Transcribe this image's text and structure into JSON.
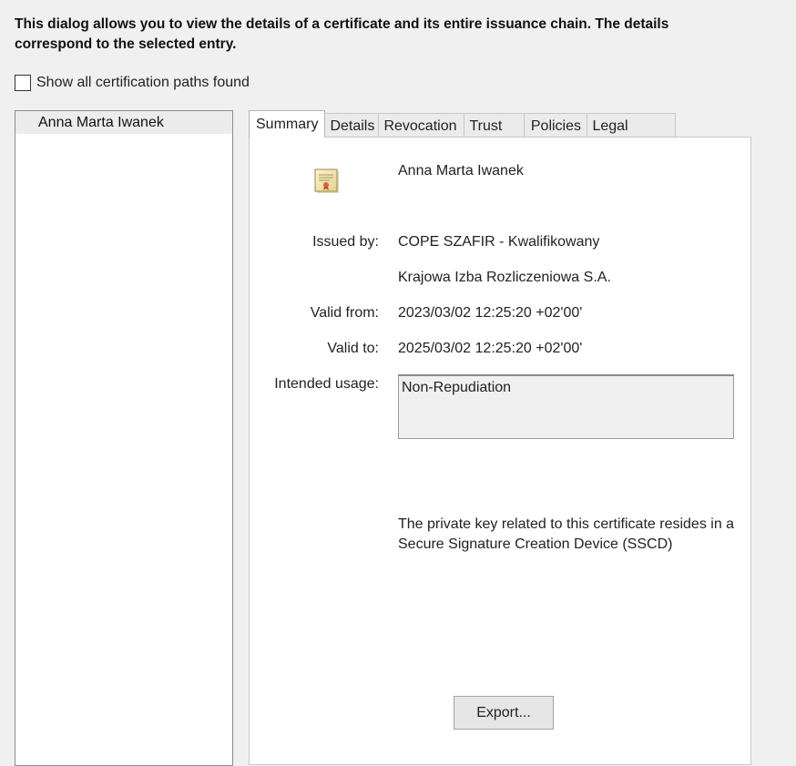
{
  "intro_text": "This dialog allows you to view the details of a certificate and its entire issuance chain. The details correspond to the selected entry.",
  "show_all_paths": {
    "label": "Show all certification paths found",
    "checked": false
  },
  "chain_tree": {
    "items": [
      {
        "label": "Anna Marta Iwanek",
        "selected": true
      }
    ]
  },
  "tabs": [
    {
      "label": "Summary",
      "active": true
    },
    {
      "label": "Details",
      "active": false
    },
    {
      "label": "Revocation",
      "active": false
    },
    {
      "label": "Trust",
      "active": false
    },
    {
      "label": "Policies",
      "active": false
    },
    {
      "label": "Legal Notice",
      "active": false
    }
  ],
  "summary": {
    "icon": "certificate-icon",
    "subject": "Anna Marta Iwanek",
    "issued_by_label": "Issued by:",
    "issued_by_line1": "COPE SZAFIR - Kwalifikowany",
    "issued_by_line2": "Krajowa Izba Rozliczeniowa S.A.",
    "valid_from_label": "Valid from:",
    "valid_from": "2023/03/02 12:25:20 +02'00'",
    "valid_to_label": "Valid to:",
    "valid_to": "2025/03/02 12:25:20 +02'00'",
    "intended_usage_label": "Intended usage:",
    "intended_usage": "Non-Repudiation",
    "sscd_note": "The private key related to this certificate resides in a Secure Signature Creation Device (SSCD)",
    "export_label": "Export..."
  }
}
